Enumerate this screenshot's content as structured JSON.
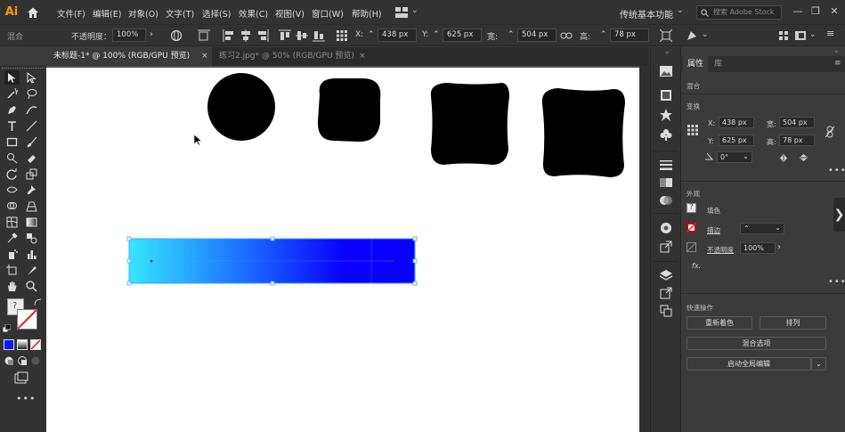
{
  "app": {
    "logo": "Ai"
  },
  "menu": [
    "文件(F)",
    "编辑(E)",
    "对象(O)",
    "文字(T)",
    "选择(S)",
    "效果(C)",
    "视图(V)",
    "窗口(W)",
    "帮助(H)"
  ],
  "workspace": "传统基本功能",
  "search": {
    "placeholder": "搜索 Adobe Stock"
  },
  "control": {
    "mode_label": "混合",
    "opacity_label": "不透明度：",
    "opacity_value": "100%",
    "x_label": "X:",
    "x_value": "438 px",
    "y_label": "Y:",
    "y_value": "625 px",
    "w_label": "宽:",
    "w_value": "504 px",
    "h_label": "高:",
    "h_value": "78 px"
  },
  "tabs": [
    {
      "label": "未标题-1* @ 100% (RGB/GPU 预览)",
      "active": true
    },
    {
      "label": "练习2.jpg* @ 50% (RGB/GPU 预览)",
      "active": false
    }
  ],
  "panel": {
    "tabs": [
      "属性",
      "库"
    ],
    "section_mix": "混合",
    "section_transform": "变换",
    "x_label": "X:",
    "x_value": "438 px",
    "y_label": "Y:",
    "y_value": "625 px",
    "w_label": "宽:",
    "w_value": "504 px",
    "h_label": "高:",
    "h_value": "78 px",
    "rotate_value": "0°",
    "section_appearance": "外观",
    "fill_label": "填色",
    "stroke_label": "描边",
    "opacity_label": "不透明度",
    "opacity_value": "100%",
    "fx_label": "fx.",
    "section_quick": "快速操作",
    "btn_recolor": "重新着色",
    "btn_arrange": "排列",
    "btn_blend_options": "混合选项",
    "btn_global_edit": "启动全局编辑"
  },
  "colors": {
    "accent": "#ff9a00",
    "gradient_start": "#36e6ff",
    "gradient_end": "#0a00ff",
    "selection": "#4aa3ff"
  }
}
